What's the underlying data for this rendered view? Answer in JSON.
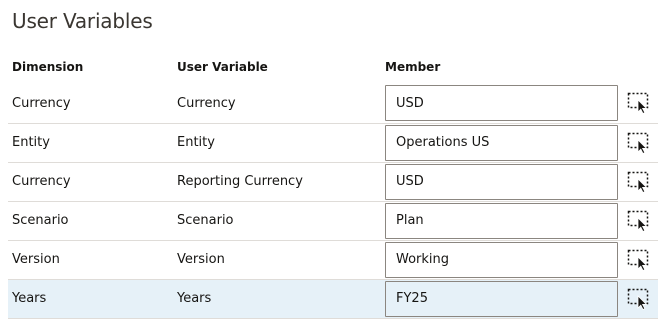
{
  "panel": {
    "title": "User Variables"
  },
  "columns": {
    "dimension": "Dimension",
    "user_variable": "User Variable",
    "member": "Member"
  },
  "rows": [
    {
      "dimension": "Currency",
      "user_variable": "Currency",
      "member": "USD",
      "selected": false
    },
    {
      "dimension": "Entity",
      "user_variable": "Entity",
      "member": "Operations US",
      "selected": false
    },
    {
      "dimension": "Currency",
      "user_variable": "Reporting Currency",
      "member": "USD",
      "selected": false
    },
    {
      "dimension": "Scenario",
      "user_variable": "Scenario",
      "member": "Plan",
      "selected": false
    },
    {
      "dimension": "Version",
      "user_variable": "Version",
      "member": "Working",
      "selected": false
    },
    {
      "dimension": "Years",
      "user_variable": "Years",
      "member": "FY25",
      "selected": true
    }
  ],
  "icons": {
    "member_selector": "member-selector-icon"
  },
  "colors": {
    "selected_row": "#e6f1f8",
    "row_divider": "#dfdcd8",
    "input_border": "#8b8680"
  }
}
